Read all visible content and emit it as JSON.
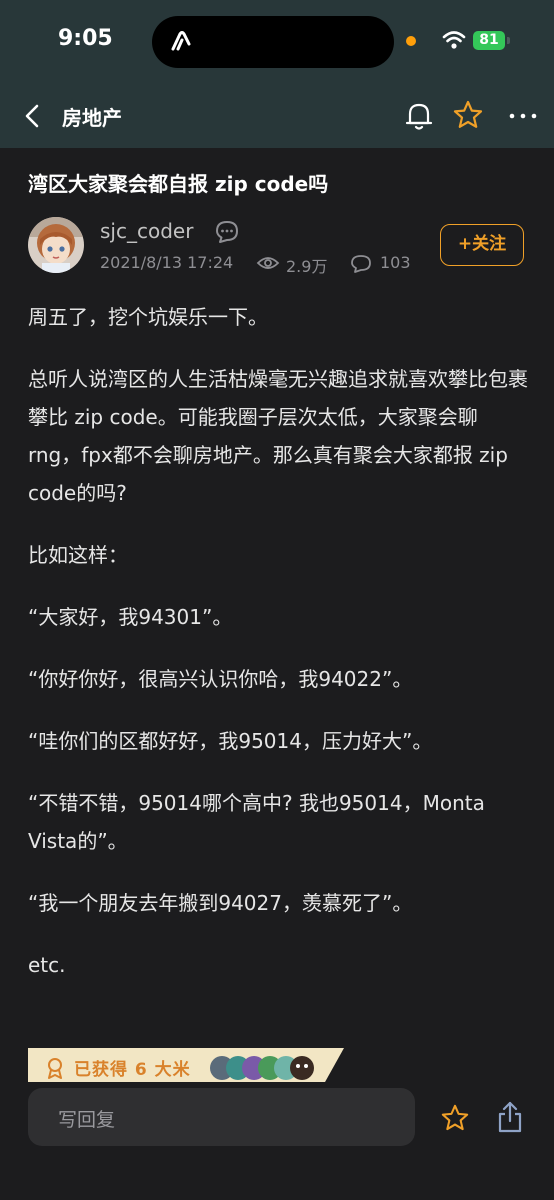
{
  "status_bar": {
    "time": "9:05",
    "battery": "81"
  },
  "nav": {
    "title": "房地产"
  },
  "post": {
    "title": "湾区大家聚会都自报 zip code吗",
    "author": "sjc_coder",
    "date": "2021/8/13 17:24",
    "views": "2.9万",
    "comments": "103",
    "follow_label": "+关注",
    "paragraphs": [
      "周五了，挖个坑娱乐一下。",
      "总听人说湾区的人生活枯燥毫无兴趣追求就喜欢攀比包裹攀比 zip code。可能我圈子层次太低，大家聚会聊rng，fpx都不会聊房地产。那么真有聚会大家都报 zip code的吗?",
      "比如这样：",
      "“大家好，我94301”。",
      "“你好你好，很高兴认识你哈，我94022”。",
      "“哇你们的区都好好，我95014，压力好大”。",
      "“不错不错，95014哪个高中? 我也95014，Monta Vista的”。",
      "“我一个朋友去年搬到94027，羡慕死了”。",
      "etc."
    ]
  },
  "award": {
    "text": "已获得 6 大米"
  },
  "reply": {
    "placeholder": "写回复"
  },
  "icons": {
    "back": "chevron-left-icon",
    "bell": "bell-icon",
    "star": "star-icon",
    "more": "more-icon",
    "chat": "chat-bubble-icon",
    "eye": "eye-icon",
    "comment": "comment-icon",
    "share": "share-icon",
    "award": "award-ribbon-icon"
  },
  "colors": {
    "accent": "#f0a028",
    "header_bg": "#283739",
    "page_bg": "#1c1c1e"
  }
}
